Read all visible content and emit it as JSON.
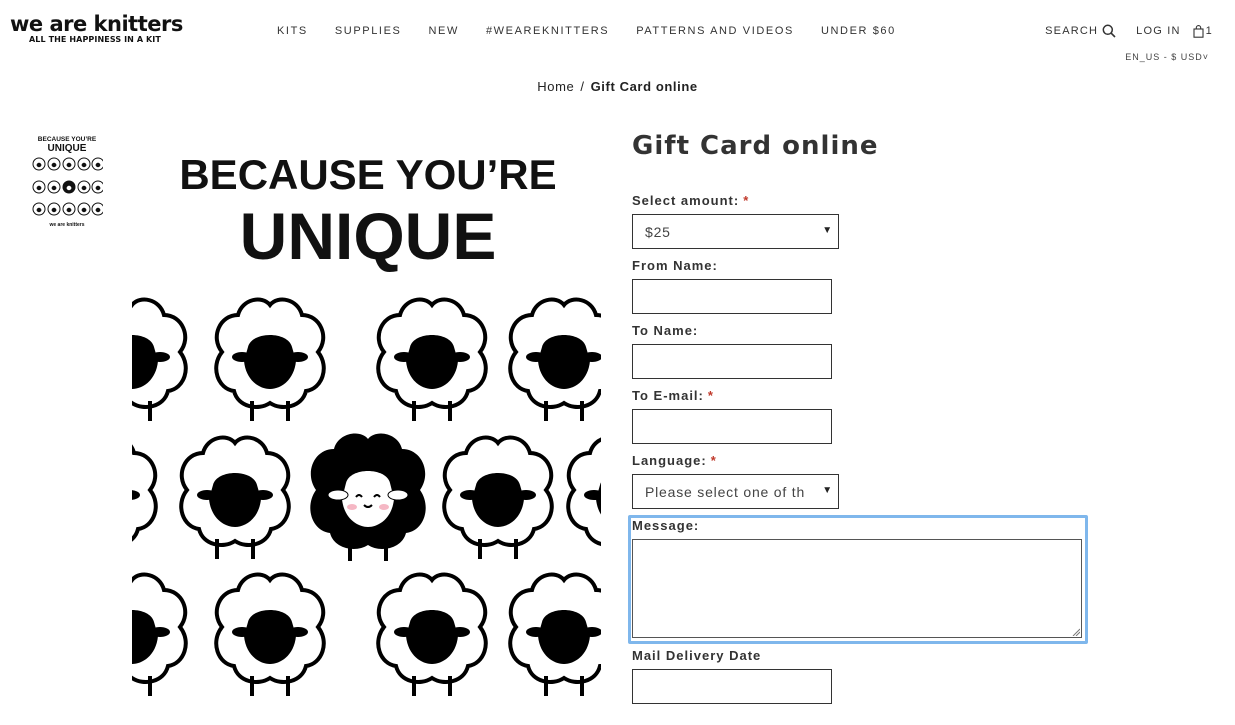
{
  "header": {
    "logo_title": "we are knitters",
    "logo_tagline": "ALL THE HAPPINESS IN A KIT",
    "nav": [
      "KITS",
      "SUPPLIES",
      "NEW",
      "#WEAREKNITTERS",
      "PATTERNS AND VIDEOS",
      "UNDER $60"
    ],
    "search_label": "SEARCH",
    "search_icon": "search-icon",
    "login_label": "LOG IN",
    "cart_icon": "shopping-bag-icon",
    "cart_count": "1",
    "locale": "EN_US - $ USD˅"
  },
  "breadcrumb": {
    "home": "Home",
    "separator": "/",
    "current": "Gift Card online"
  },
  "product_image": {
    "headline_top": "BECAUSE YOU’RE",
    "headline_bottom": "UNIQUE",
    "thumb_brand": "we are knitters"
  },
  "product": {
    "title": "Gift Card online",
    "required_mark": "*",
    "select_amount": {
      "label": "Select amount:",
      "value": "$25"
    },
    "from_name": {
      "label": "From Name:",
      "value": ""
    },
    "to_name": {
      "label": "To Name:",
      "value": ""
    },
    "to_email": {
      "label": "To E-mail:",
      "value": ""
    },
    "language": {
      "label": "Language:",
      "value": "Please select one of th"
    },
    "message": {
      "label": "Message:",
      "value": ""
    },
    "mail_delivery_date": {
      "label": "Mail Delivery Date",
      "value": ""
    }
  },
  "colors": {
    "focus": "#7fb7ec",
    "required": "#c0392b",
    "text": "#333333"
  }
}
